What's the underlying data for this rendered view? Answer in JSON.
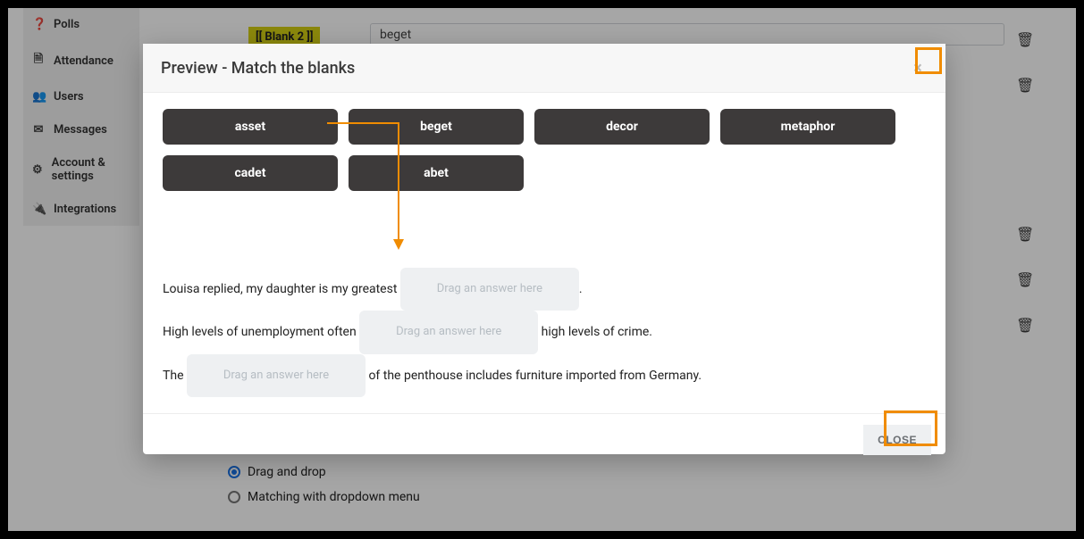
{
  "sidebar": {
    "items": [
      {
        "icon": "?",
        "label": "Polls"
      },
      {
        "icon": "📄",
        "label": "Attendance"
      },
      {
        "icon": "👥",
        "label": "Users"
      },
      {
        "icon": "✉",
        "label": "Messages"
      },
      {
        "icon": "⚙",
        "label": "Account & settings"
      },
      {
        "icon": "🔌",
        "label": "Integrations"
      }
    ]
  },
  "editor": {
    "blank_chip": "[[ Blank 2 ]]",
    "input_value": "beget"
  },
  "options": {
    "drag_label": "Drag and drop",
    "dropdown_label": "Matching with dropdown menu"
  },
  "modal": {
    "title": "Preview - Match the blanks",
    "close_x": "×",
    "tiles": [
      "asset",
      "beget",
      "decor",
      "metaphor",
      "cadet",
      "abet"
    ],
    "drop_placeholder": "Drag an answer here",
    "sentences": {
      "s1_pre": "Louisa replied, my daughter is my greatest ",
      "s1_post": ".",
      "s2_pre": "High levels of unemployment often ",
      "s2_post": " high levels of crime.",
      "s3_pre": "The ",
      "s3_post": " of the penthouse includes furniture imported from Germany."
    },
    "close_button": "CLOSE"
  }
}
